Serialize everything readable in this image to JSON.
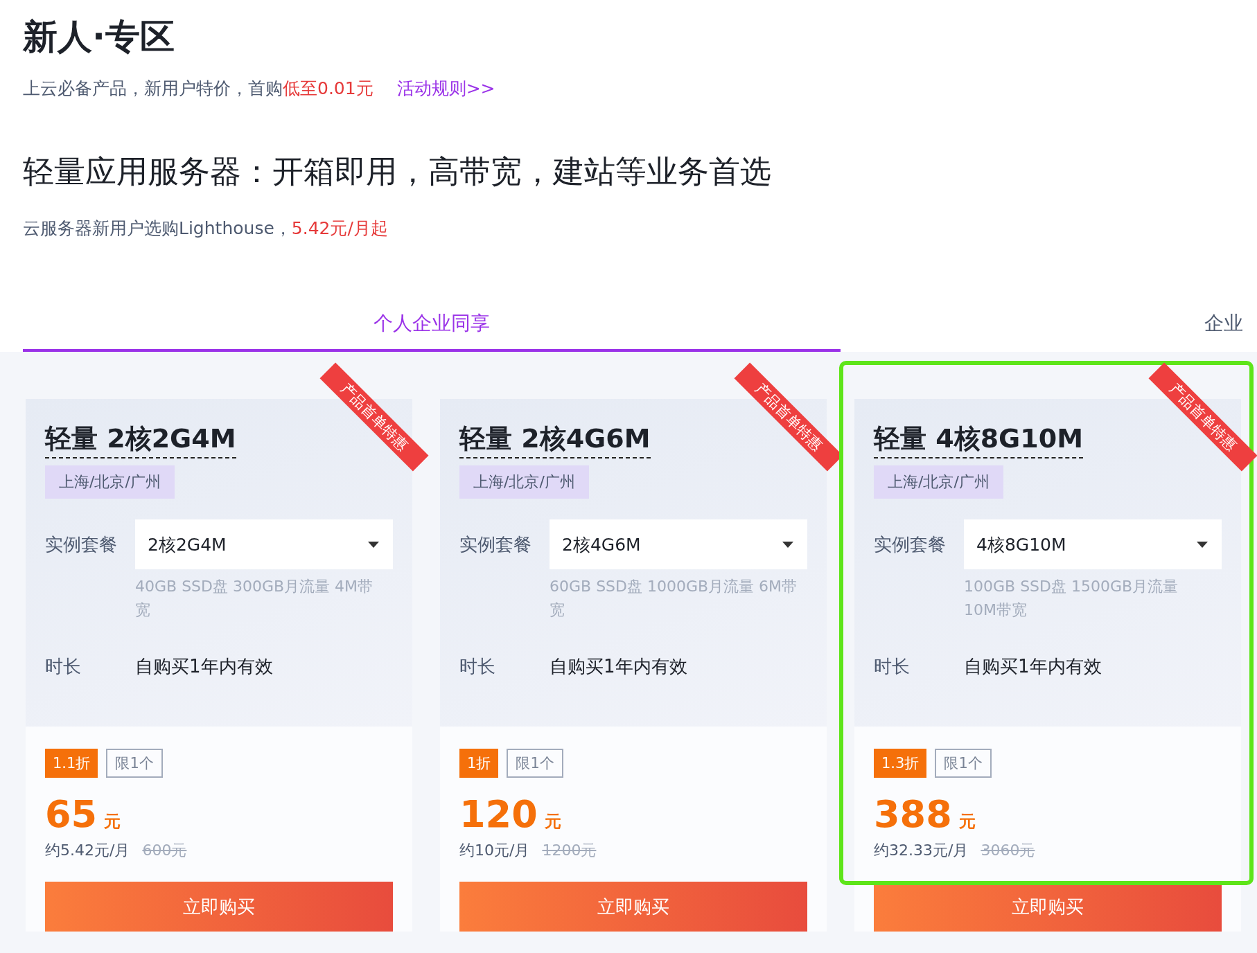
{
  "header": {
    "title": "新人·专区",
    "subtitle": "上云必备产品，新用户特价，首购",
    "subtitle_highlight": "低至0.01元",
    "rules_link": "活动规则>>"
  },
  "section": {
    "title": "轻量应用服务器：开箱即用，高带宽，建站等业务首选",
    "subtitle": "云服务器新用户选购Lighthouse，",
    "subtitle_highlight": "5.42元/月起"
  },
  "tabs": [
    {
      "label": "个人企业同享",
      "selected": true
    },
    {
      "label": "企业",
      "selected": false
    }
  ],
  "cards": [
    {
      "title": "轻量 2核2G4M",
      "ribbon": "产品首单特惠",
      "regions": "上海/北京/广州",
      "plan_label": "实例套餐",
      "plan_value": "2核2G4M",
      "spec": "40GB SSD盘 300GB月流量 4M带宽",
      "duration_label": "时长",
      "duration_value": "自购买1年内有效",
      "discount": "1.1折",
      "limit": "限1个",
      "price": "65",
      "unit": "元",
      "monthly": "约5.42元/月",
      "original_price": "600元",
      "button": "立即购买",
      "highlighted": false
    },
    {
      "title": "轻量 2核4G6M",
      "ribbon": "产品首单特惠",
      "regions": "上海/北京/广州",
      "plan_label": "实例套餐",
      "plan_value": "2核4G6M",
      "spec": "60GB SSD盘 1000GB月流量 6M带宽",
      "duration_label": "时长",
      "duration_value": "自购买1年内有效",
      "discount": "1折",
      "limit": "限1个",
      "price": "120",
      "unit": "元",
      "monthly": "约10元/月",
      "original_price": "1200元",
      "button": "立即购买",
      "highlighted": false
    },
    {
      "title": "轻量 4核8G10M",
      "ribbon": "产品首单特惠",
      "regions": "上海/北京/广州",
      "plan_label": "实例套餐",
      "plan_value": "4核8G10M",
      "spec": "100GB SSD盘 1500GB月流量 10M带宽",
      "duration_label": "时长",
      "duration_value": "自购买1年内有效",
      "discount": "1.3折",
      "limit": "限1个",
      "price": "388",
      "unit": "元",
      "monthly": "约32.33元/月",
      "original_price": "3060元",
      "button": "立即购买",
      "highlighted": true
    }
  ]
}
